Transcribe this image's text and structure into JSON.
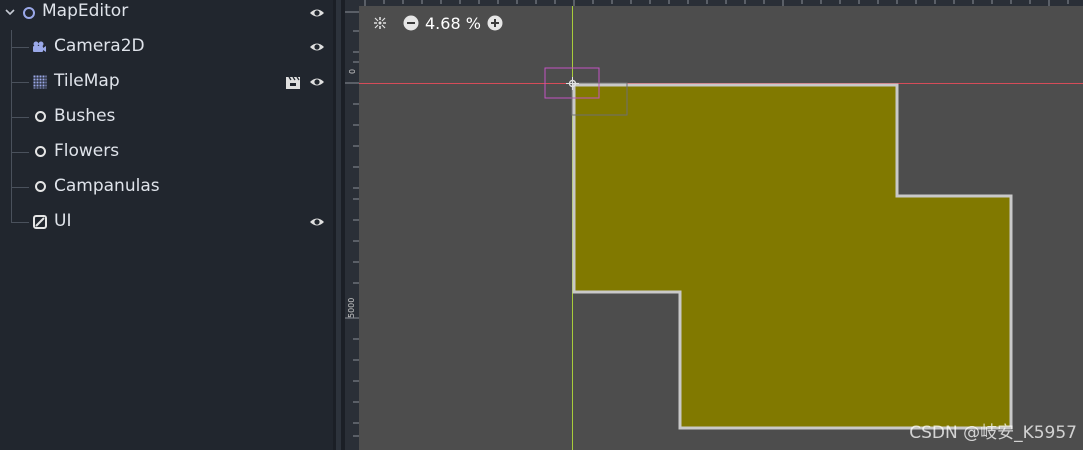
{
  "scene_tree": {
    "root": {
      "label": "MapEditor",
      "icon": "node-icon",
      "visible": true
    },
    "children": [
      {
        "label": "Camera2D",
        "icon": "camera-icon",
        "visible": true
      },
      {
        "label": "TileMap",
        "icon": "tilemap-icon",
        "visible": true,
        "extra_icon": "clapperboard-icon"
      },
      {
        "label": "Bushes",
        "icon": "node-icon"
      },
      {
        "label": "Flowers",
        "icon": "node-icon"
      },
      {
        "label": "Campanulas",
        "icon": "node-icon"
      },
      {
        "label": "UI",
        "icon": "control-icon",
        "visible": true
      }
    ]
  },
  "viewport": {
    "zoom_label": "4.68 %",
    "ruler_left_labels": [
      "0",
      "5000"
    ],
    "colors": {
      "background": "#4d4d4d",
      "polygon_fill": "#817900",
      "polygon_outline": "#c9c9c9",
      "x_axis": "#d64c59",
      "y_axis": "#a8cc3a",
      "selection": "#c353c3"
    }
  },
  "watermark": "CSDN @岐安_K5957"
}
